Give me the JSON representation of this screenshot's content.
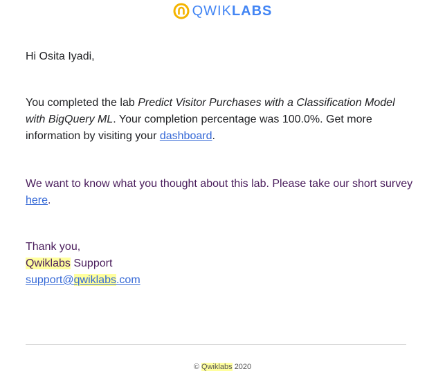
{
  "brand": {
    "logo_prefix": "QWIK",
    "logo_suffix": "LABS",
    "accent_color": "#4285f4",
    "mark_color": "#f4b400"
  },
  "email": {
    "greeting": "Hi Osita Iyadi,",
    "completion": {
      "intro": "You completed the lab ",
      "lab_name": "Predict Visitor Purchases with a Classification Model with BigQuery ML",
      "middle": ". Your completion percentage was 100.0%. Get more information by visiting your ",
      "link_label": "dashboard",
      "end": "."
    },
    "survey": {
      "text": "We want to know what you thought about this lab. Please take our short survey ",
      "link_label": "here",
      "end": "."
    },
    "signoff": {
      "thanks": "Thank you,",
      "team_brand": "Qwiklabs",
      "team_suffix": " Support",
      "email_user": "support@",
      "email_brand": "qwiklabs",
      "email_domain": ".com"
    }
  },
  "footer": {
    "copyright_symbol": "©",
    "brand": "Qwiklabs",
    "year": "2020"
  }
}
